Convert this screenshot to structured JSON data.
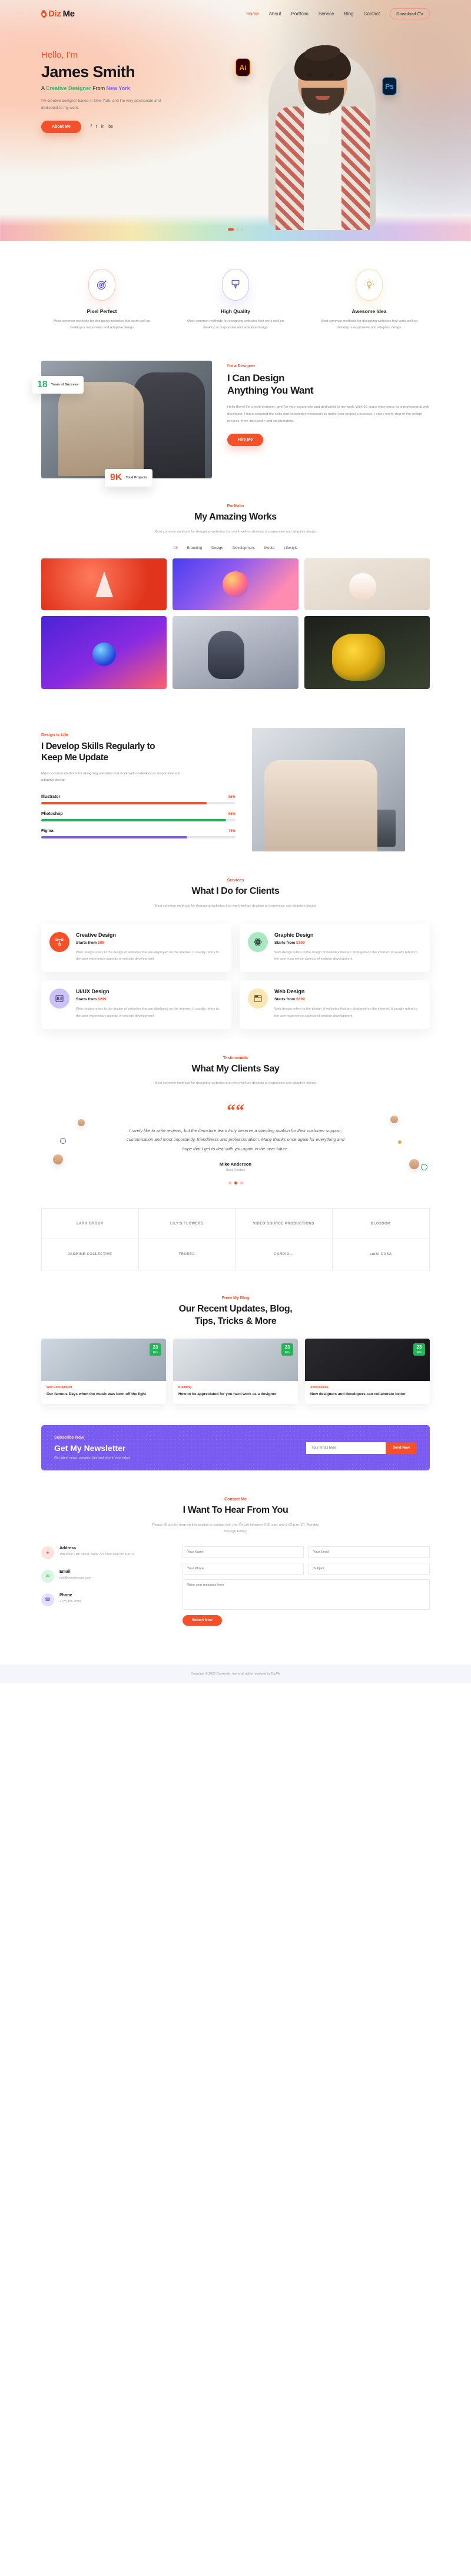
{
  "brand": {
    "name_first": "Diz",
    "name_second": "Me",
    "accent": "#f4502a"
  },
  "nav": {
    "items": [
      {
        "label": "Home",
        "active": true
      },
      {
        "label": "About",
        "active": false
      },
      {
        "label": "Portfolio",
        "active": false
      },
      {
        "label": "Service",
        "active": false
      },
      {
        "label": "Blog",
        "active": false
      },
      {
        "label": "Contact",
        "active": false
      }
    ],
    "cta": "Download CV"
  },
  "hero": {
    "greeting": "Hello, I'm",
    "name": "James Smith",
    "sub_a": "A ",
    "sub_green": "Creative Designer",
    "sub_b": " From ",
    "sub_purple": "New York",
    "desc": "I'm creative designer based in New York, and I'm very passionate and dedicated to my work.",
    "button": "About Me",
    "socials": [
      "f",
      "t",
      "in",
      "be"
    ],
    "badges": [
      {
        "label": "Ai"
      },
      {
        "label": "Ps"
      }
    ]
  },
  "features": {
    "items": [
      {
        "title": "Pixel Perfect",
        "icon": "target-icon",
        "desc": "Most common methods for designing websites that work well on desktop is responsive and adaptive design"
      },
      {
        "title": "High Quality",
        "icon": "brush-icon",
        "desc": "Most common methods for designing websites that work well on desktop is responsive and adaptive design"
      },
      {
        "title": "Awesome Idea",
        "icon": "lightbulb-icon",
        "desc": "Most common methods for designing websites that work well on desktop is responsive and adaptive design"
      }
    ]
  },
  "about": {
    "eyebrow": "I'm a Designer",
    "title_line1": "I Can Design",
    "title_line2": "Anything You Want",
    "desc": "Hello there! I'm a web designer, and I'm very passionate and dedicated to my work. With 20 years experience as a professional web developer, I have acquired the skills and knowledge necessary to make your project a success. I enjoy every step of the design process, from discussion and collaboration.",
    "button": "Hire Me",
    "stats": [
      {
        "num": "18",
        "label": "Years of Success"
      },
      {
        "num": "9K",
        "label": "Total Projects"
      }
    ]
  },
  "portfolio": {
    "eyebrow": "Portfolio",
    "title": "My Amazing Works",
    "desc": "Most common methods for designing websites that work well on desktop is responsive and adaptive design",
    "filters": [
      {
        "label": "All",
        "active": true
      },
      {
        "label": "Branding",
        "active": false
      },
      {
        "label": "Design",
        "active": false
      },
      {
        "label": "Development",
        "active": false
      },
      {
        "label": "Media",
        "active": false
      },
      {
        "label": "Lifestyle",
        "active": false
      }
    ]
  },
  "skills": {
    "eyebrow": "Design is Life",
    "title_line1": "I Develop Skills Regularly to",
    "title_line2": "Keep Me Update",
    "desc": "Most common methods for designing websites that work well on desktop is responsive and adaptive design",
    "bars": [
      {
        "name": "Illustrator",
        "pct": "85%",
        "value": 85,
        "color": "#f4502a"
      },
      {
        "name": "Photoshop",
        "pct": "95%",
        "value": 95,
        "color": "#22b455"
      },
      {
        "name": "Figma",
        "pct": "75%",
        "value": 75,
        "color": "#7b5cf0"
      }
    ]
  },
  "services": {
    "eyebrow": "Services",
    "title": "What I Do for Clients",
    "desc": "Most common methods for designing websites that work well on desktop is responsive and adaptive design",
    "items": [
      {
        "title": "Creative Design",
        "price_label": "Starts from",
        "price": "$99",
        "icon": "node-path-icon",
        "desc": "Web design refers to the design of websites that are displayed on the internet. It usually refers to the user experience aspects of website development"
      },
      {
        "title": "Graphic Design",
        "price_label": "Starts from",
        "price": "$199",
        "icon": "atom-icon",
        "desc": "Web design refers to the design of websites that are displayed on the internet. It usually refers to the user experience aspects of website development"
      },
      {
        "title": "UI/UX Design",
        "price_label": "Starts from",
        "price": "$299",
        "icon": "id-card-icon",
        "desc": "Web design refers to the design of websites that are displayed on the internet. It usually refers to the user experience aspects of website development"
      },
      {
        "title": "Web Design",
        "price_label": "Starts from",
        "price": "$399",
        "icon": "browser-window-icon",
        "desc": "Web design refers to the design of websites that are displayed on the internet. It usually refers to the user experience aspects of website development"
      }
    ]
  },
  "testimonials": {
    "eyebrow": "Testimonials",
    "title": "What My Clients Say",
    "desc": "Most common methods for designing websites that work well on desktop is responsive and adaptive design",
    "quote": "I rarely like to write reviews, but the itemstore team truly deserve a standing ovation for their customer support, customisation and most importantly, friendliness and professionalism. Many thanks once again for everything and hope that I get to deal with you again in the near future.",
    "author": "Mike Anderson",
    "role": "Nexa Studios"
  },
  "brands": {
    "items": [
      {
        "label": "LARK GROUP"
      },
      {
        "label": "LILY'S FLOWERS"
      },
      {
        "label": "VIDEO SOURCE PRODUCTIONS"
      },
      {
        "label": "BLOSSOM"
      },
      {
        "label": "JASMINE COLLECTIVE"
      },
      {
        "label": "TRUEEA"
      },
      {
        "label": "CARDIO—"
      },
      {
        "label": "suthi CASA"
      }
    ]
  },
  "blog": {
    "eyebrow": "From My Blog",
    "title_line1": "Our Recent Updates, Blog,",
    "title_line2": "Tips, Tricks & More",
    "posts": [
      {
        "date_day": "23",
        "date_month": "Dec",
        "cat": "Web Development",
        "title": "Our famous Days when the music was born off the light"
      },
      {
        "date_day": "23",
        "date_month": "Dec",
        "cat": "Branding",
        "title": "How to be appreciated for you hard work as a designer"
      },
      {
        "date_day": "23",
        "date_month": "Dec",
        "cat": "Accessibility",
        "title": "New designers and developers can collaborate better"
      }
    ]
  },
  "newsletter": {
    "eyebrow": "Subscribe Now",
    "title": "Get My Newsletter",
    "desc": "Get latest news, updates, tips and trics in your inbox",
    "placeholder": "Your email here",
    "button": "Send Now"
  },
  "contact": {
    "eyebrow": "Contact Me",
    "title": "I Want To Hear From You",
    "desc": "Please fill out the form on this section to contact with me. Or call between 9:00 a.m. and 8:00 p.m. ET, Monday through Friday",
    "info": [
      {
        "icon": "location-pin-icon",
        "label": "Address",
        "value": "198 West 21th Street, Suite 721 New York NY 10016"
      },
      {
        "icon": "envelope-icon",
        "label": "Email",
        "value": "info@yourdomain.com"
      },
      {
        "icon": "phone-icon",
        "label": "Phone",
        "value": "+123 456 7890"
      }
    ],
    "form": {
      "name_placeholder": "Your Name",
      "email_placeholder": "Your Email",
      "phone_placeholder": "Your Phone",
      "subject_placeholder": "Subject",
      "message_placeholder": "Write your message here",
      "submit": "Submit Now"
    }
  },
  "footer": {
    "text": "Copyright © 2022 Dizmesite, name all rights reserved by DizMe"
  }
}
